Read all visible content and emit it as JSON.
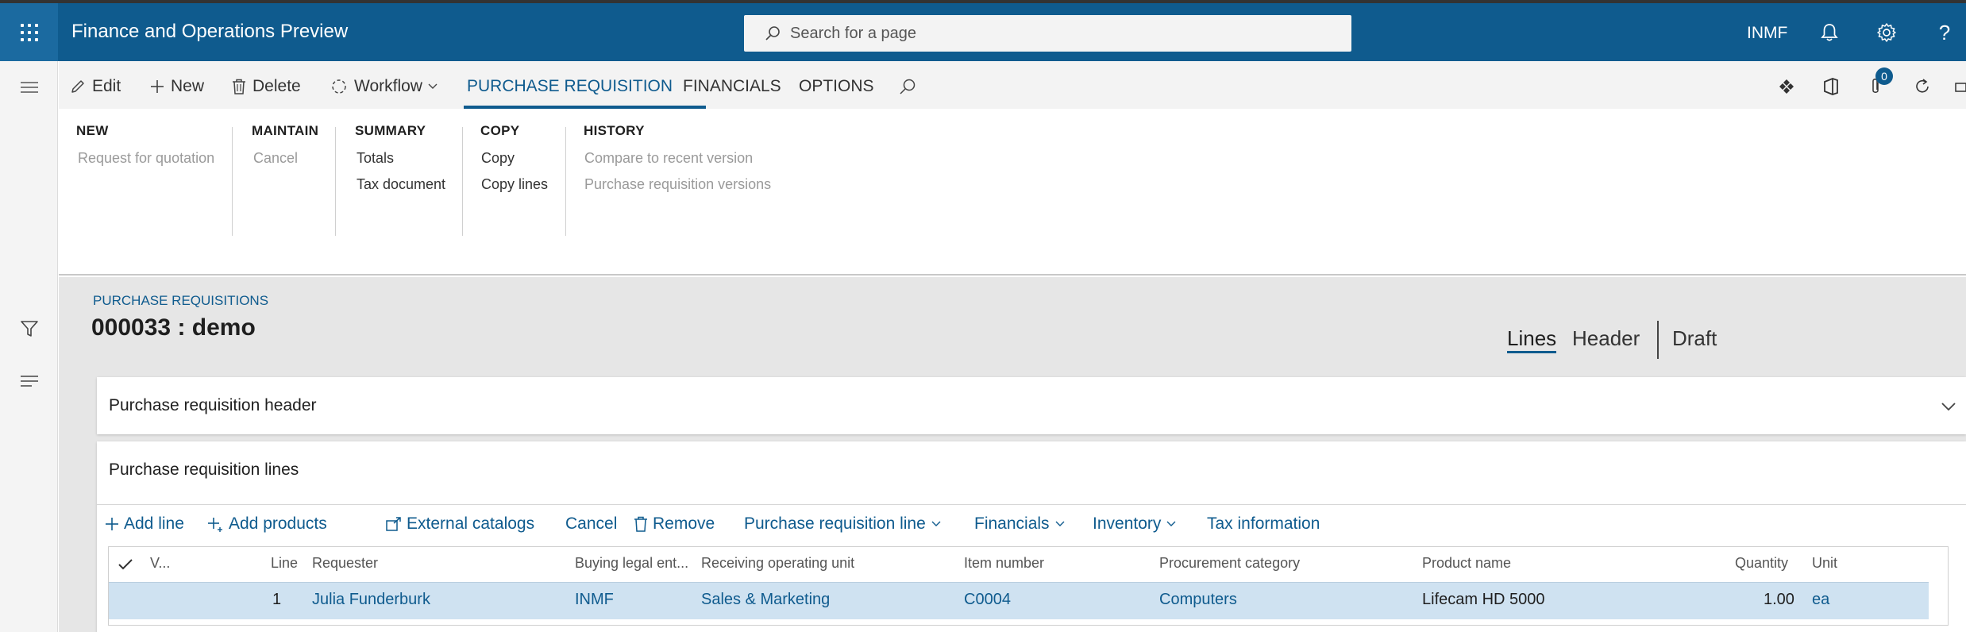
{
  "app": {
    "title": "Finance and Operations Preview",
    "company": "INMF",
    "search_placeholder": "Search for a page"
  },
  "navbar_icons": [
    "waffle-icon",
    "bell-icon",
    "gear-icon",
    "help-icon"
  ],
  "action_pane": {
    "commands": {
      "edit": "Edit",
      "new": "New",
      "delete": "Delete",
      "workflow": "Workflow"
    },
    "tabs": [
      "PURCHASE REQUISITION",
      "FINANCIALS",
      "OPTIONS"
    ],
    "active_tab": "PURCHASE REQUISITION",
    "right_badge": "0",
    "groups": [
      {
        "title": "NEW",
        "items": [
          "Request for quotation"
        ]
      },
      {
        "title": "MAINTAIN",
        "items": [
          "Cancel"
        ]
      },
      {
        "title": "SUMMARY",
        "items": [
          "Totals",
          "Tax document"
        ]
      },
      {
        "title": "COPY",
        "items": [
          "Copy",
          "Copy lines"
        ]
      },
      {
        "title": "HISTORY",
        "items": [
          "Compare to recent version",
          "Purchase requisition versions"
        ]
      }
    ]
  },
  "record": {
    "breadcrumb": "PURCHASE REQUISITIONS",
    "title": "000033 : demo",
    "views": [
      "Lines",
      "Header"
    ],
    "active_view": "Lines",
    "status": "Draft"
  },
  "header_fasttab": {
    "title": "Purchase requisition header"
  },
  "lines_fasttab": {
    "title": "Purchase requisition lines",
    "commands": {
      "add_line": "Add line",
      "add_products": "Add products",
      "external_catalogs": "External catalogs",
      "cancel": "Cancel",
      "remove": "Remove",
      "pr_line": "Purchase requisition line",
      "financials": "Financials",
      "inventory": "Inventory",
      "tax_information": "Tax information"
    },
    "columns": {
      "v": "V...",
      "line": "Line",
      "requester": "Requester",
      "buying_legal_entity": "Buying legal ent...",
      "receiving_unit": "Receiving operating unit",
      "item_number": "Item number",
      "procurement_category": "Procurement category",
      "product_name": "Product name",
      "quantity": "Quantity",
      "unit": "Unit"
    },
    "rows": [
      {
        "line": "1",
        "requester": "Julia Funderburk",
        "buying_legal_entity": "INMF",
        "receiving_unit": "Sales & Marketing",
        "item_number": "C0004",
        "procurement_category": "Computers",
        "product_name": "Lifecam HD 5000",
        "quantity": "1.00",
        "unit": "ea"
      }
    ]
  }
}
